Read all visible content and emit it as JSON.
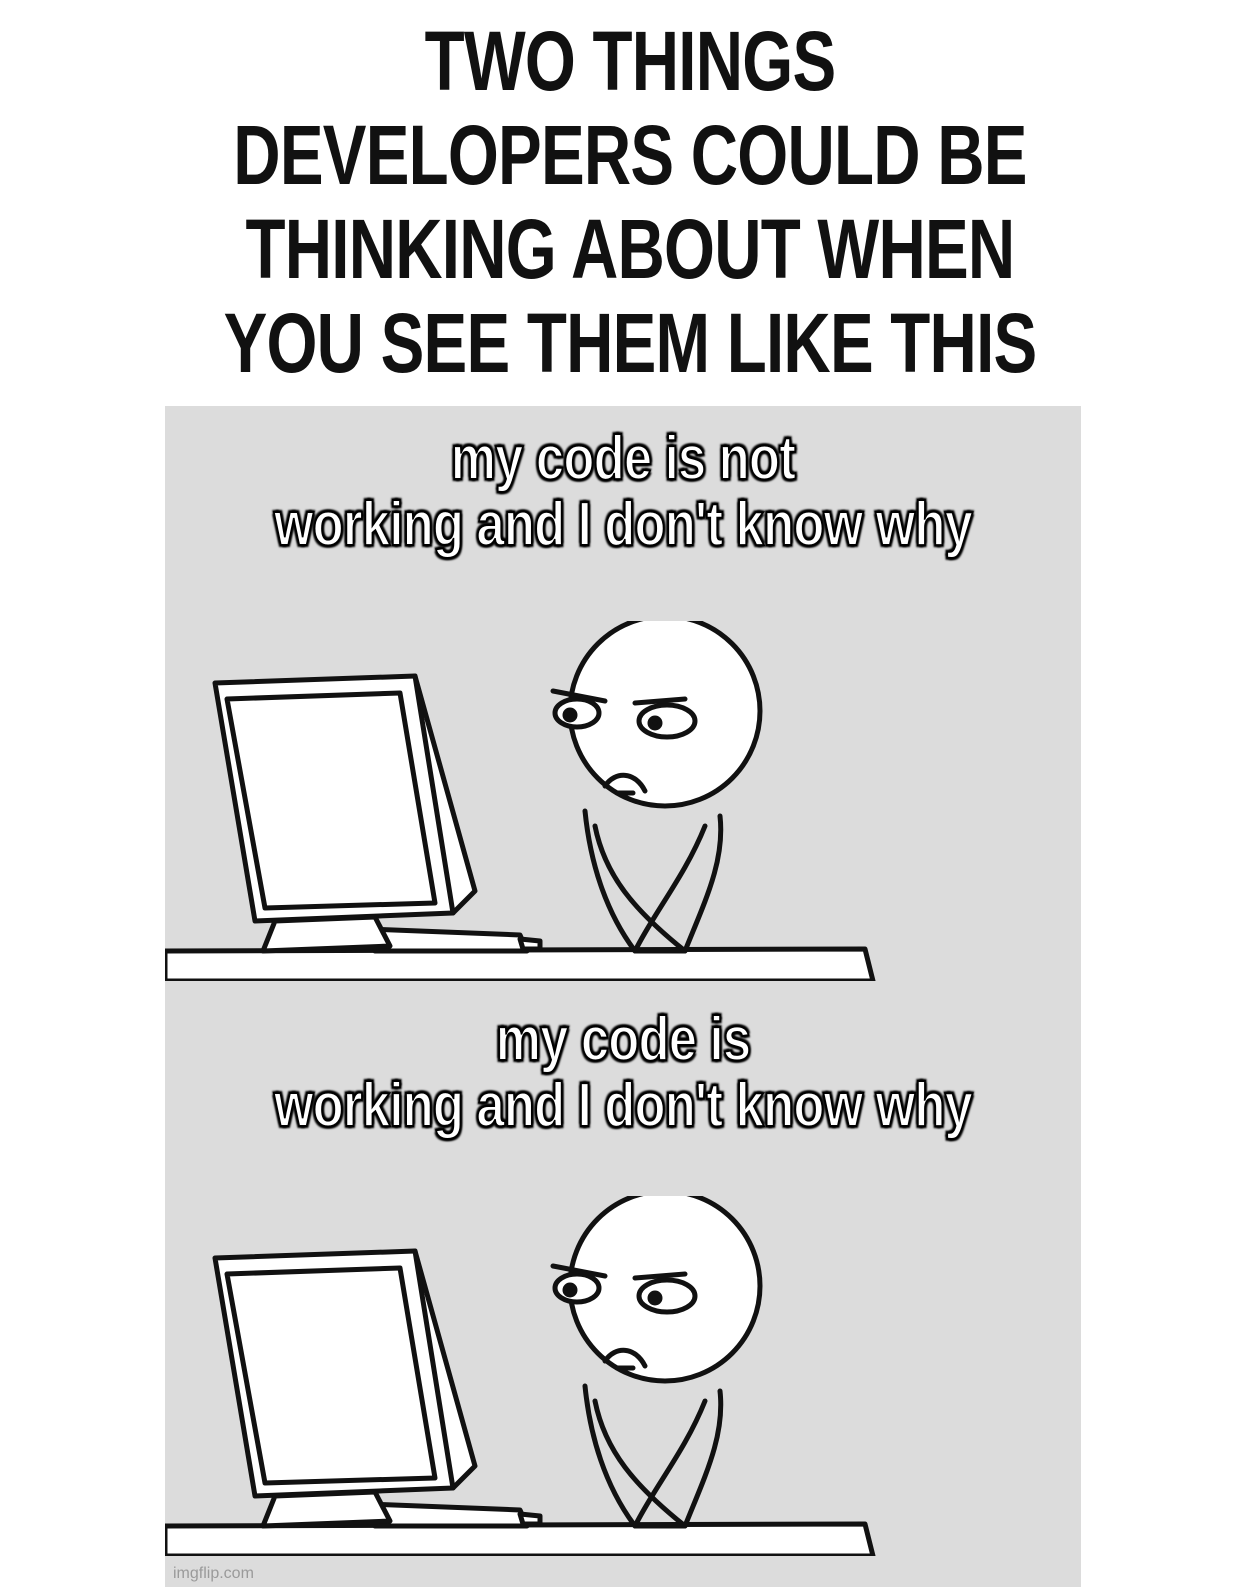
{
  "headline": {
    "lines": [
      "TWO THINGS",
      "DEVELOPERS COULD BE",
      "THINKING ABOUT WHEN",
      "YOU SEE THEM LIKE THIS"
    ]
  },
  "panels": [
    {
      "caption_lines": [
        "my code is not",
        "working and I don't know why"
      ]
    },
    {
      "caption_lines": [
        "my code is",
        "working and I don't know why"
      ]
    }
  ],
  "watermark": "imgflip.com",
  "colors": {
    "panel_background": "#dcdcdc",
    "caption_fill": "#ffffff",
    "caption_outline": "#000000",
    "headline_text": "#111111"
  }
}
